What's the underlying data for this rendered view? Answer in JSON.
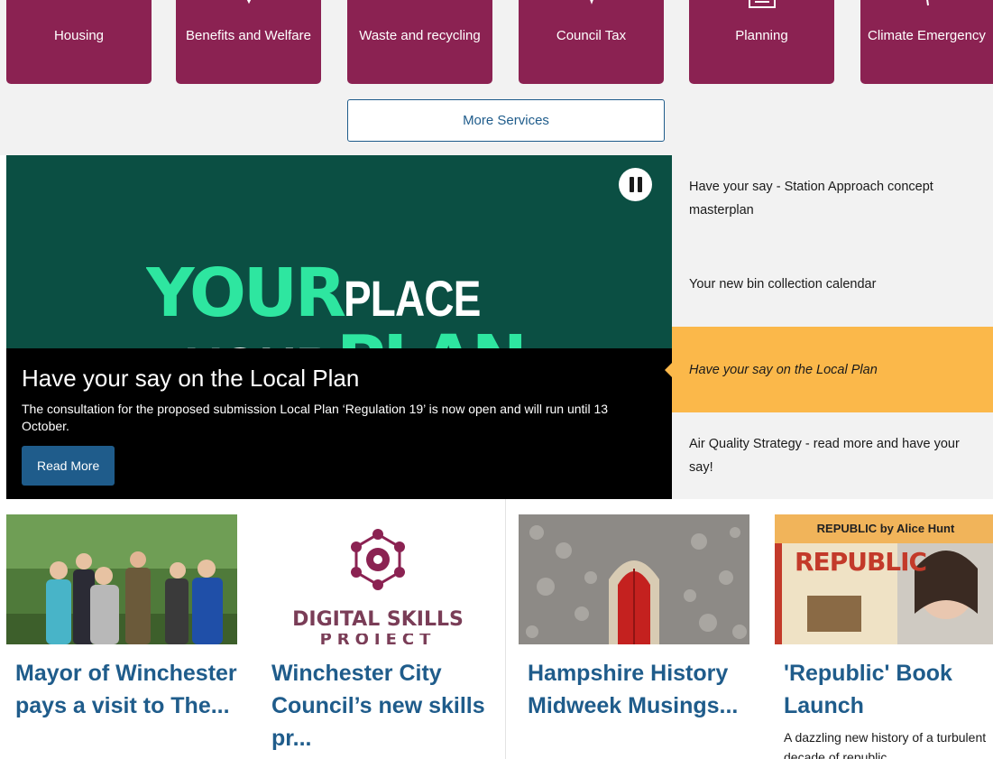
{
  "services": {
    "tiles": [
      {
        "label": "Housing",
        "icon": "house-icon"
      },
      {
        "label": "Benefits and Welfare",
        "icon": "hands-icon"
      },
      {
        "label": "Waste and recycling",
        "icon": "bin-icon"
      },
      {
        "label": "Council Tax",
        "icon": "coins-icon"
      },
      {
        "label": "Planning",
        "icon": "plan-icon"
      },
      {
        "label": "Climate Emergency",
        "icon": "leaf-icon"
      }
    ],
    "more_label": "More Services"
  },
  "carousel": {
    "hero": {
      "line1_green": "YOUR",
      "line1_white": "PLACE",
      "line2_white": "YOUR",
      "line2_green": "PLAN"
    },
    "caption_title": "Have your say on the Local Plan",
    "caption_text": "The consultation for the proposed submission Local Plan ‘Regulation 19’ is now open and will run until 13 October.",
    "read_more": "Read More",
    "pause_icon": "pause-icon"
  },
  "slides": [
    {
      "label": "Have your say - Station Approach concept masterplan",
      "active": false
    },
    {
      "label": "Your new bin collection calendar",
      "active": false
    },
    {
      "label": "Have your say on the Local Plan",
      "active": true
    },
    {
      "label": "Air Quality Strategy - read more and have your say!",
      "active": false
    }
  ],
  "news": [
    {
      "title": "Mayor of Winchester pays a visit to The...",
      "desc": ""
    },
    {
      "title": "Winchester City Council’s new skills pr...",
      "desc": "",
      "logo_text": "DIGITAL SKILLS",
      "logo_sub": "PROJECT"
    },
    {
      "title": "Hampshire History Midweek Musings...",
      "desc": ""
    },
    {
      "title": "'Republic' Book Launch",
      "desc": "A dazzling new history of a turbulent decade of republic",
      "cover_banner": "REPUBLIC by Alice Hunt",
      "cover_title": "REPUBLIC"
    }
  ],
  "colors": {
    "tile": "#8b2252",
    "accent_blue": "#1f5c8b",
    "active_slide": "#fbb84a",
    "hero_green": "#0b4f43",
    "hero_text_green": "#2ee6a0"
  }
}
